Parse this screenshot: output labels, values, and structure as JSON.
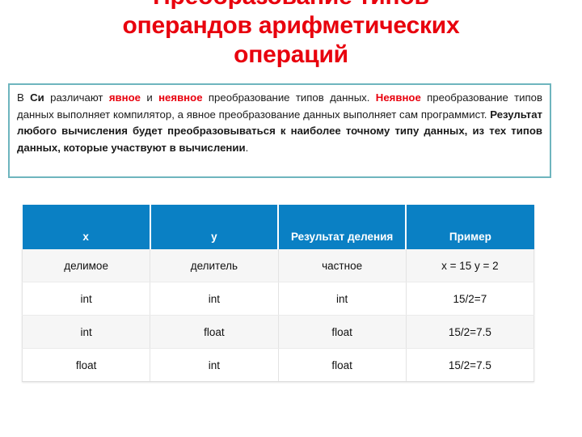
{
  "slide": {
    "title": "Преобразование типов\nоперандов арифметических\nопераций",
    "title_color": "#E8000D"
  },
  "callout": {
    "border_color": "#6EB5BE",
    "segments": [
      {
        "text": "В ",
        "style": "normal"
      },
      {
        "text": "Си",
        "style": "bold"
      },
      {
        "text": " различают ",
        "style": "normal"
      },
      {
        "text": "явное",
        "style": "red-bold"
      },
      {
        "text": " и ",
        "style": "normal"
      },
      {
        "text": "неявное",
        "style": "red-bold"
      },
      {
        "text": " преобразование типов данных. ",
        "style": "normal"
      },
      {
        "text": "Неявное",
        "style": "red-bold"
      },
      {
        "text": " преобразование типов данных выполняет компилятор, а явное преобразование данных выполняет сам программист. ",
        "style": "normal"
      },
      {
        "text": "Результат любого вычисления будет преобразовываться к наиболее точному типу данных, из тех типов данных, которые участвуют в вычислении",
        "style": "bold"
      },
      {
        "text": ".",
        "style": "normal"
      }
    ],
    "plain_text": "В Си различают явное и неявное преобразование типов данных. Неявное преобразование типов данных выполняет компилятор, а явное преобразование данных выполняет сам программист. Результат любого вычисления будет преобразовываться к наиболее точному типу данных, из тех типов данных, которые участвуют в вычислении."
  },
  "table": {
    "header_bg": "#0A80C4",
    "header_color": "#FFFFFF",
    "columns": [
      "x",
      "y",
      "Результат деления",
      "Пример"
    ],
    "rows": [
      [
        "делимое",
        "делитель",
        "частное",
        "x = 15 y = 2"
      ],
      [
        "int",
        "int",
        "int",
        "15/2=7"
      ],
      [
        "int",
        "float",
        "float",
        "15/2=7.5"
      ],
      [
        "float",
        "int",
        "float",
        "15/2=7.5"
      ]
    ]
  }
}
